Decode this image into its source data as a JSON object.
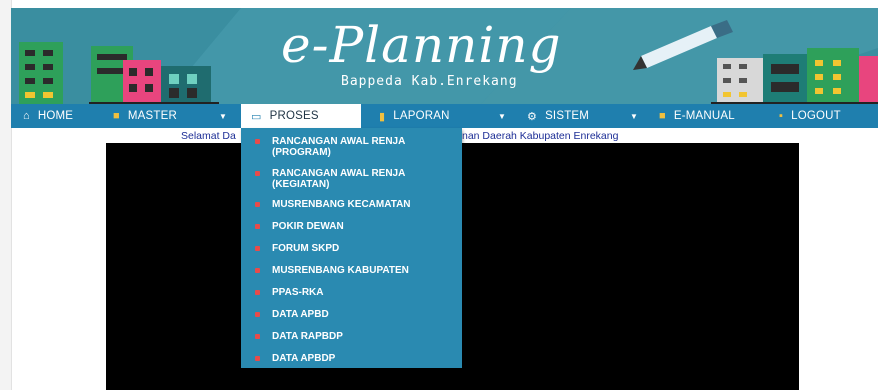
{
  "header": {
    "logo_title": "e-Planning",
    "logo_subtitle": "Bappeda Kab.Enrekang",
    "colors": {
      "banner": "#3a8ea0",
      "navbar": "#1f7fae",
      "dropdown": "#2a8ab1"
    }
  },
  "nav": {
    "items": [
      {
        "label": "HOME",
        "icon": "home-icon"
      },
      {
        "label": "MASTER",
        "icon": "folder-icon"
      },
      {
        "label": "PROSES",
        "icon": "book-icon"
      },
      {
        "label": "LAPORAN",
        "icon": "bar-chart-icon"
      },
      {
        "label": "SISTEM",
        "icon": "gear-icon"
      },
      {
        "label": "E-MANUAL",
        "icon": "folder-icon"
      },
      {
        "label": "LOGOUT",
        "icon": "logout-icon"
      }
    ]
  },
  "dropdown": {
    "items": [
      {
        "label": "RANCANGAN AWAL RENJA (PROGRAM)"
      },
      {
        "label": "RANCANGAN AWAL RENJA (KEGIATAN)"
      },
      {
        "label": "MUSRENBANG KECAMATAN"
      },
      {
        "label": "POKIR DEWAN"
      },
      {
        "label": "FORUM SKPD"
      },
      {
        "label": "MUSRENBANG KABUPATEN"
      },
      {
        "label": "PPAS-RKA"
      },
      {
        "label": "DATA APBD"
      },
      {
        "label": "DATA RAPBDP"
      },
      {
        "label": "DATA APBDP"
      }
    ]
  },
  "welcome": {
    "left": "Selamat Da",
    "right": "nan Daerah Kabupaten Enrekang"
  }
}
